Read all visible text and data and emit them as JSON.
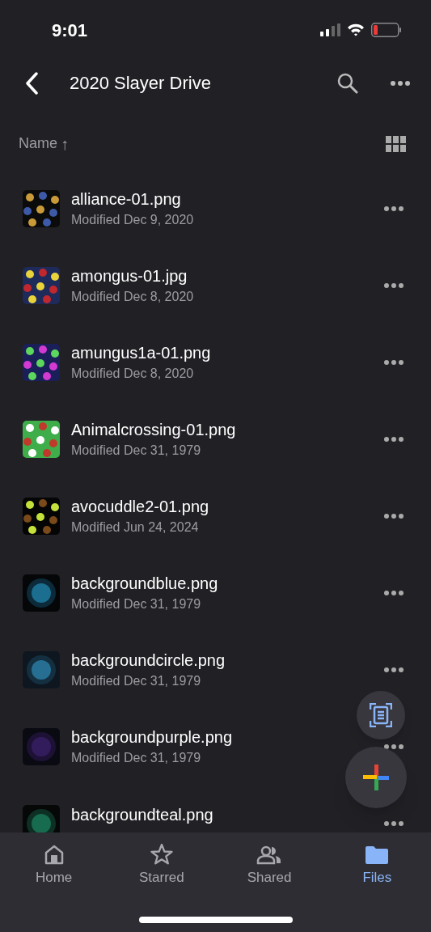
{
  "status_bar": {
    "time": "9:01"
  },
  "header": {
    "title": "2020 Slayer Drive"
  },
  "sort": {
    "label": "Name",
    "arrow": "↑"
  },
  "files": [
    {
      "name": "alliance-01.png",
      "modified": "Modified Dec 9, 2020"
    },
    {
      "name": "amongus-01.jpg",
      "modified": "Modified Dec 8, 2020"
    },
    {
      "name": "amungus1a-01.png",
      "modified": "Modified Dec 8, 2020"
    },
    {
      "name": "Animalcrossing-01.png",
      "modified": "Modified Dec 31, 1979"
    },
    {
      "name": "avocuddle2-01.png",
      "modified": "Modified Jun 24, 2024"
    },
    {
      "name": "backgroundblue.png",
      "modified": "Modified Dec 31, 1979"
    },
    {
      "name": "backgroundcircle.png",
      "modified": "Modified Dec 31, 1979"
    },
    {
      "name": "backgroundpurple.png",
      "modified": "Modified Dec 31, 1979"
    },
    {
      "name": "backgroundteal.png"
    }
  ],
  "tabs": [
    {
      "label": "Home",
      "kind": "home",
      "selected": false
    },
    {
      "label": "Starred",
      "kind": "star",
      "selected": false
    },
    {
      "label": "Shared",
      "kind": "people",
      "selected": false
    },
    {
      "label": "Files",
      "kind": "folder",
      "selected": true
    }
  ]
}
